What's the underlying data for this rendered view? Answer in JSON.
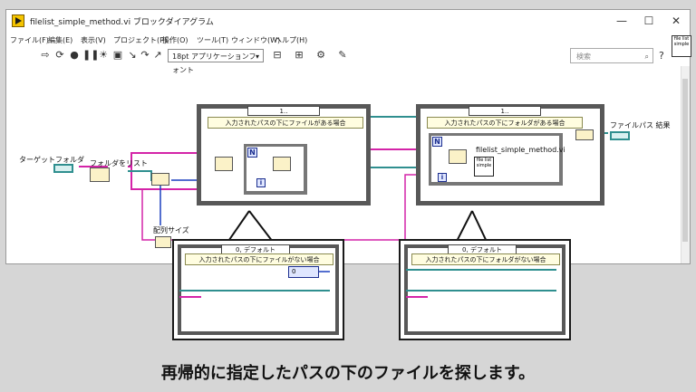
{
  "window": {
    "title": "filelist_simple_method.vi ブロックダイアグラム",
    "minimize": "—",
    "maximize": "☐",
    "close": "✕"
  },
  "menu": [
    "ファイル(F)",
    "編集(E)",
    "表示(V)",
    "プロジェクト(P)",
    "操作(O)",
    "ツール(T)",
    "ウィンドウ(W)",
    "ヘルプ(H)"
  ],
  "toolbar": {
    "font_select": "18pt アプリケーションフォント",
    "search_placeholder": "検索",
    "help": "?"
  },
  "vi_icon": "file list simple",
  "diagram": {
    "label_target_folder": "ターゲットフォルダ",
    "label_list_folder": "フォルダをリスト",
    "label_array_size": "配列サイズ",
    "label_file_path_result": "ファイルパス 結果",
    "case1": {
      "selector": "1..",
      "caption": "入力されたパスの下にファイルがある場合"
    },
    "case2": {
      "selector": "1..",
      "caption": "入力されたパスの下にフォルダがある場合",
      "subvi_label": "filelist_simple_method.vi",
      "subvi_icon": "file list simple"
    },
    "for_n": "N",
    "for_i": "i"
  },
  "popups": [
    {
      "selector": "0, デフォルト",
      "caption": "入力されたパスの下にファイルがない場合",
      "const": "0"
    },
    {
      "selector": "0, デフォルト",
      "caption": "入力されたパスの下にフォルダがない場合"
    }
  ],
  "caption": "再帰的に指定したパスの下のファイルを探します。"
}
